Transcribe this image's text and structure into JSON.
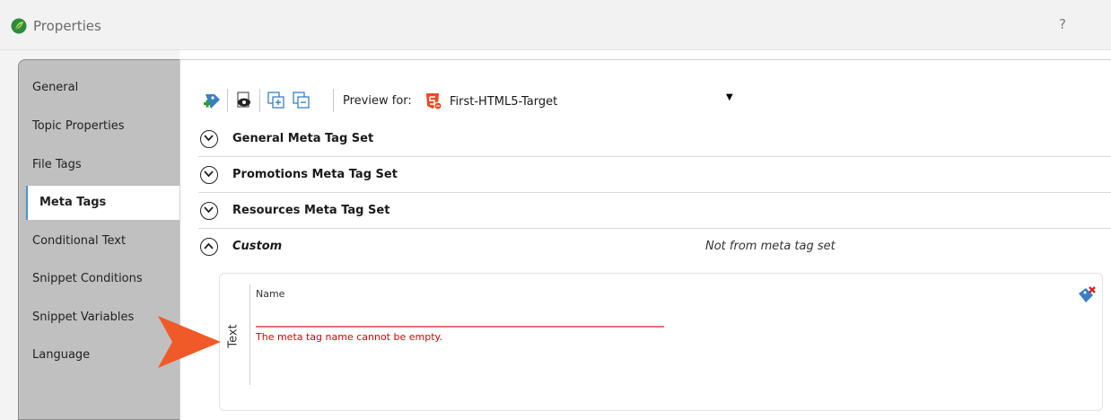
{
  "window": {
    "title": "Properties",
    "help_label": "?"
  },
  "sidebar": {
    "items": [
      {
        "label": "General",
        "active": false
      },
      {
        "label": "Topic Properties",
        "active": false
      },
      {
        "label": "File Tags",
        "active": false
      },
      {
        "label": "Meta Tags",
        "active": true
      },
      {
        "label": "Conditional Text",
        "active": false
      },
      {
        "label": "Snippet Conditions",
        "active": false
      },
      {
        "label": "Snippet Variables",
        "active": false
      },
      {
        "label": "Language",
        "active": false
      }
    ]
  },
  "toolbar": {
    "icons": [
      "add-meta-tag-icon",
      "preview-icon",
      "expand-all-icon",
      "collapse-all-icon"
    ],
    "preview_label": "Preview for:",
    "preview_value": "First-HTML5-Target"
  },
  "meta_sets": [
    {
      "label": "General Meta Tag Set",
      "expanded": false
    },
    {
      "label": "Promotions Meta Tag Set",
      "expanded": false
    },
    {
      "label": "Resources Meta Tag Set",
      "expanded": false
    },
    {
      "label": "Custom",
      "expanded": true,
      "note": "Not from meta tag set"
    }
  ],
  "custom_panel": {
    "type_label": "Text",
    "name_label": "Name",
    "name_value": "",
    "error": "The meta tag name cannot be empty."
  },
  "colors": {
    "accent": "#4a8fd8",
    "error": "#e00000",
    "arrow": "#f05a28",
    "app_icon": "#2f8a3e"
  }
}
